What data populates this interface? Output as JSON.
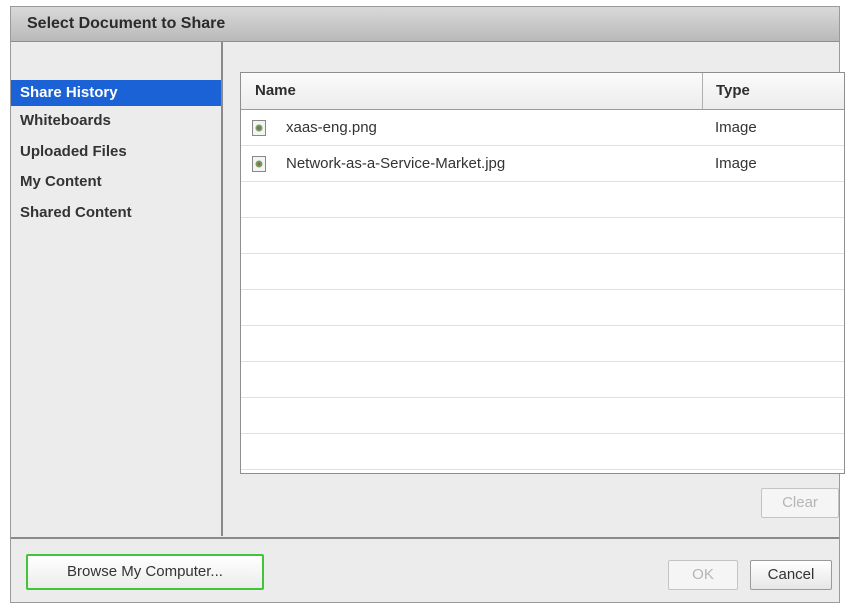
{
  "dialog": {
    "title": "Select Document to Share"
  },
  "sidebar": {
    "items": [
      {
        "label": "Share History",
        "active": true
      },
      {
        "label": "Whiteboards",
        "active": false
      },
      {
        "label": "Uploaded Files",
        "active": false
      },
      {
        "label": "My Content",
        "active": false
      },
      {
        "label": "Shared Content",
        "active": false
      }
    ]
  },
  "table": {
    "columns": [
      "Name",
      "Type"
    ],
    "rows": [
      {
        "name": "xaas-eng.png",
        "type": "Image",
        "icon": "image-file-icon"
      },
      {
        "name": "Network-as-a-Service-Market.jpg",
        "type": "Image",
        "icon": "image-file-icon"
      }
    ]
  },
  "buttons": {
    "clear": "Clear",
    "browse": "Browse My Computer...",
    "ok": "OK",
    "cancel": "Cancel"
  },
  "colors": {
    "accent": "#1b62d6",
    "browse_focus": "#41c43a"
  }
}
